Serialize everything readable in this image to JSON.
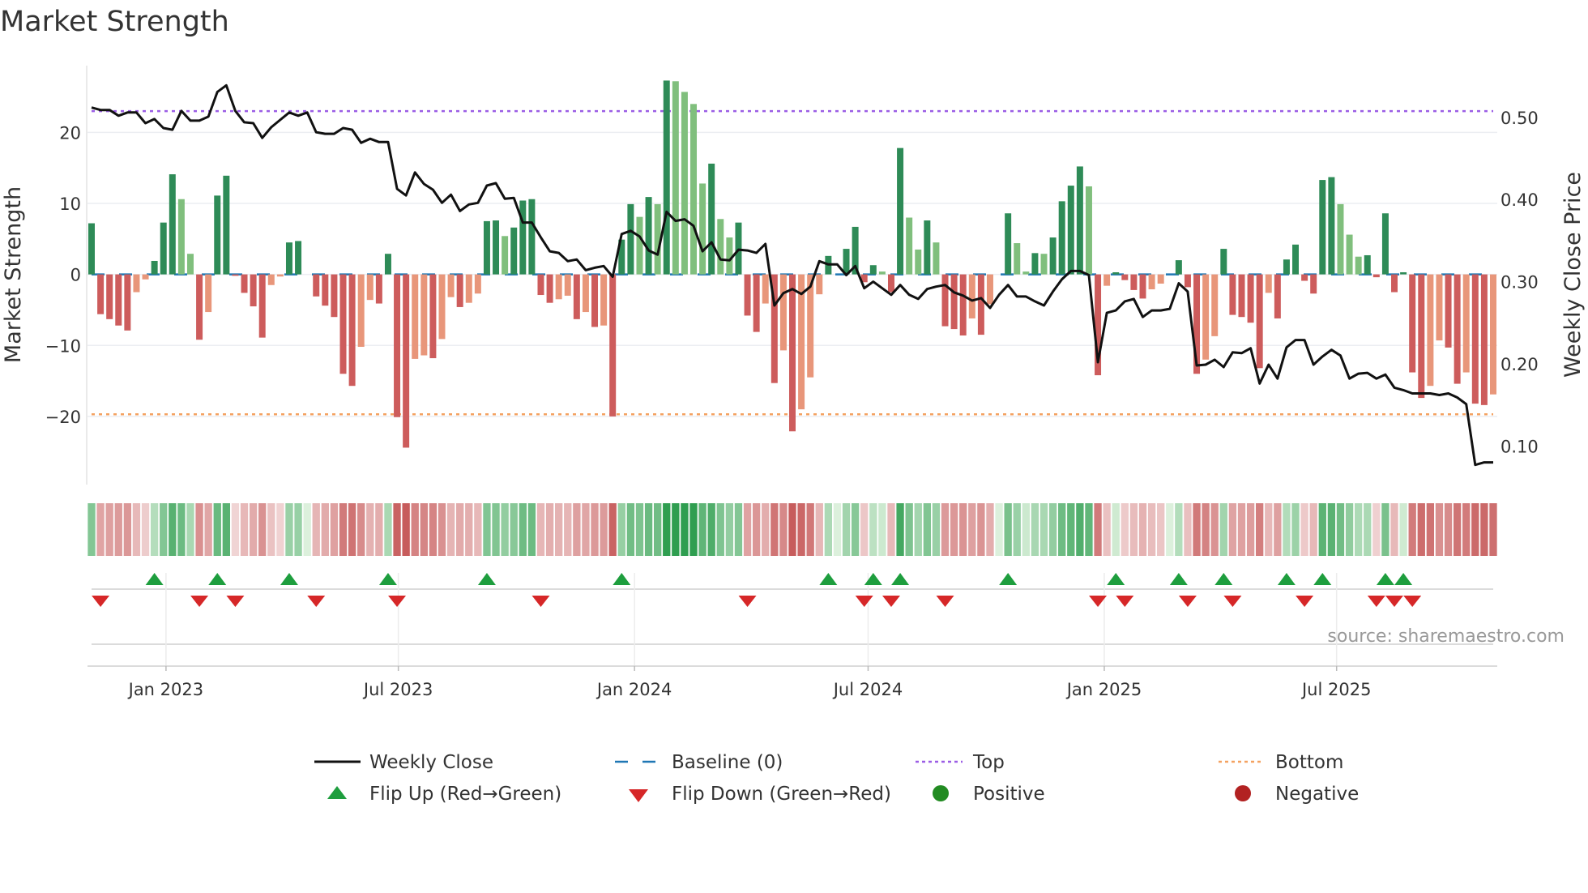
{
  "chart_data": {
    "type": "bar",
    "title": "Market Strength",
    "ylabel": "Market Strength",
    "y2label": "Weekly Close Price",
    "ylim": [
      -29.6,
      29.4
    ],
    "y2lim": [
      0.053,
      0.563
    ],
    "yticks": [
      -20,
      -10,
      0,
      10,
      20
    ],
    "ytick_labels": [
      "−20",
      "−10",
      "0",
      "10",
      "20"
    ],
    "y2ticks": [
      0.1,
      0.2,
      0.3,
      0.4,
      0.5
    ],
    "y2tick_labels": [
      "0.10",
      "0.20",
      "0.30",
      "0.40",
      "0.50"
    ],
    "first_week": "2022-11-04",
    "frequency": "weekly",
    "xticks": [
      "2023-01-01",
      "2023-07-01",
      "2024-01-01",
      "2024-07-01",
      "2025-01-01",
      "2025-07-01"
    ],
    "xtick_labels": [
      "Jan 2023",
      "Jul 2023",
      "Jan 2024",
      "Jul 2024",
      "Jan 2025",
      "Jul 2025"
    ],
    "top_level": 23,
    "bottom_level": -19.7,
    "baseline": 0,
    "grid": true,
    "strength": [
      7.2,
      -5.6,
      -6.3,
      -7.2,
      -7.9,
      -2.5,
      -0.7,
      1.9,
      7.3,
      14.1,
      10.6,
      2.9,
      -9.2,
      -5.3,
      11.1,
      13.9,
      -0.2,
      -2.6,
      -4.5,
      -8.9,
      -1.5,
      -0.3,
      4.5,
      4.7,
      0,
      -3.1,
      -4.4,
      -6.0,
      -14.0,
      -15.7,
      -10.2,
      -3.6,
      -4.1,
      2.9,
      -20.1,
      -24.4,
      -11.9,
      -11.4,
      -11.8,
      -9.1,
      -3.2,
      -4.6,
      -4.0,
      -2.7,
      7.5,
      7.6,
      5.4,
      6.6,
      10.4,
      10.6,
      -2.9,
      -4.0,
      -3.5,
      -3.0,
      -6.3,
      -5.3,
      -7.4,
      -7.2,
      -20.0,
      4.9,
      9.9,
      8.1,
      10.9,
      9.9,
      27.3,
      27.2,
      25.7,
      24.0,
      12.8,
      15.6,
      7.8,
      5.2,
      7.3,
      -5.8,
      -8.1,
      -4.1,
      -15.3,
      -10.7,
      -22.1,
      -19.0,
      -14.5,
      -2.8,
      2.6,
      0,
      3.6,
      6.7,
      -1.1,
      1.3,
      0.4,
      -2.5,
      17.8,
      8.0,
      3.5,
      7.6,
      4.5,
      -7.3,
      -7.7,
      -8.6,
      -6.2,
      -8.5,
      -4.2,
      0,
      8.6,
      4.4,
      0.4,
      3.0,
      2.9,
      5.2,
      10.3,
      12.5,
      15.2,
      12.4,
      -14.2,
      -1.6,
      0.3,
      -0.8,
      -2.2,
      -3.4,
      -2.1,
      -1.3,
      0,
      2.0,
      -1.8,
      -14.0,
      -12.0,
      -8.7,
      3.6,
      -5.7,
      -6.0,
      -6.8,
      -13.2,
      -2.6,
      -6.2,
      2.1,
      4.2,
      -0.9,
      -2.7,
      13.3,
      13.7,
      9.9,
      5.6,
      2.5,
      2.7,
      -0.4,
      8.6,
      -2.5,
      0.3,
      -13.8,
      -17.4,
      -15.7,
      -9.3,
      -10.3,
      -15.4,
      -13.8,
      -18.2,
      -18.4,
      -16.9
    ],
    "weekly_close": [
      0.512,
      0.509,
      0.509,
      0.502,
      0.506,
      0.506,
      0.493,
      0.498,
      0.487,
      0.485,
      0.508,
      0.496,
      0.496,
      0.501,
      0.531,
      0.539,
      0.508,
      0.494,
      0.493,
      0.475,
      0.488,
      0.497,
      0.506,
      0.502,
      0.506,
      0.482,
      0.48,
      0.48,
      0.487,
      0.485,
      0.469,
      0.474,
      0.47,
      0.47,
      0.413,
      0.405,
      0.433,
      0.419,
      0.412,
      0.396,
      0.406,
      0.386,
      0.394,
      0.396,
      0.417,
      0.42,
      0.401,
      0.402,
      0.372,
      0.372,
      0.354,
      0.337,
      0.335,
      0.325,
      0.327,
      0.314,
      0.317,
      0.319,
      0.306,
      0.358,
      0.362,
      0.355,
      0.338,
      0.333,
      0.385,
      0.374,
      0.376,
      0.368,
      0.337,
      0.348,
      0.327,
      0.326,
      0.339,
      0.338,
      0.335,
      0.346,
      0.271,
      0.286,
      0.291,
      0.285,
      0.294,
      0.325,
      0.321,
      0.321,
      0.308,
      0.319,
      0.292,
      0.3,
      0.292,
      0.284,
      0.296,
      0.284,
      0.279,
      0.291,
      0.294,
      0.296,
      0.287,
      0.283,
      0.277,
      0.28,
      0.268,
      0.284,
      0.296,
      0.282,
      0.282,
      0.276,
      0.271,
      0.288,
      0.303,
      0.313,
      0.313,
      0.308,
      0.202,
      0.262,
      0.265,
      0.276,
      0.279,
      0.257,
      0.265,
      0.265,
      0.267,
      0.298,
      0.288,
      0.198,
      0.199,
      0.205,
      0.196,
      0.214,
      0.213,
      0.219,
      0.176,
      0.199,
      0.182,
      0.22,
      0.229,
      0.229,
      0.199,
      0.209,
      0.217,
      0.21,
      0.182,
      0.188,
      0.189,
      0.182,
      0.187,
      0.171,
      0.168,
      0.164,
      0.164,
      0.164,
      0.162,
      0.164,
      0.159,
      0.151,
      0.077,
      0.08,
      0.08
    ],
    "legend_placement": "bottom-center",
    "legend": {
      "weekly_close": "Weekly Close",
      "baseline": "Baseline (0)",
      "top": "Top",
      "bottom": "Bottom",
      "flip_up": "Flip Up (Red→Green)",
      "flip_down": "Flip Down (Green→Red)",
      "positive": "Positive",
      "negative": "Negative"
    },
    "source": "source: sharemaestro.com"
  },
  "colors": {
    "strong_positive": "#2e8b57",
    "weak_positive": "#80bf7d",
    "strong_negative": "#cd5c5c",
    "weak_negative": "#e8967a",
    "line": "#111111",
    "top": "#9b5de5",
    "bottom": "#f4a261",
    "baseline": "#1f77b4",
    "flip_up": "#1e9e3e",
    "flip_down": "#d62728",
    "positive_dot": "#228b22",
    "negative_dot": "#b22222"
  }
}
